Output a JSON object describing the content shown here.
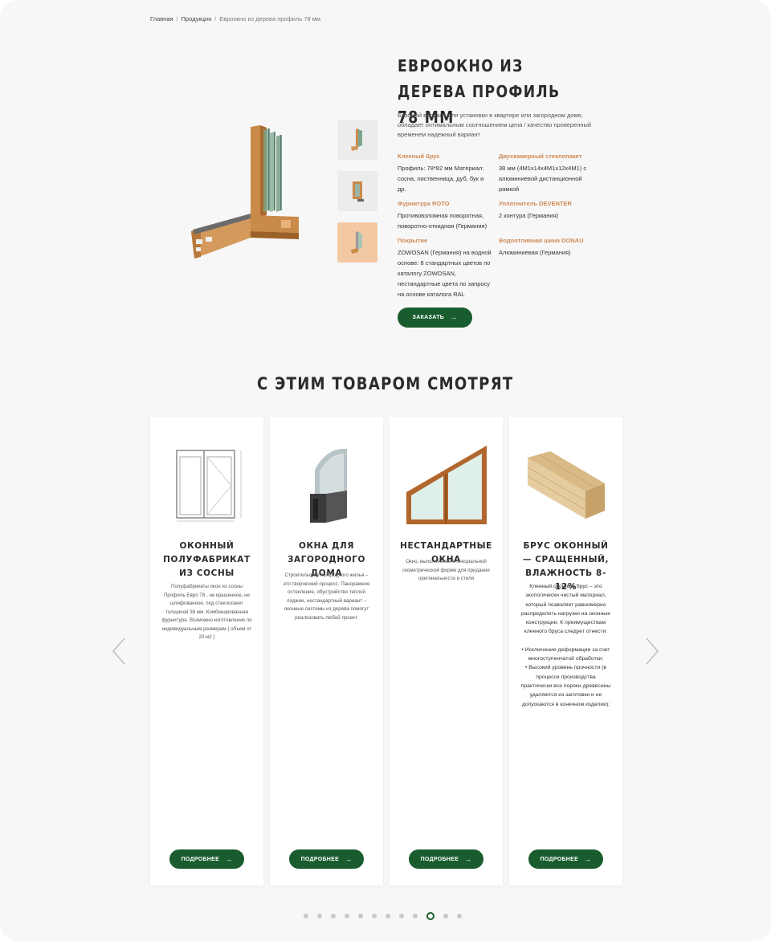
{
  "breadcrumb": {
    "home": "Главная",
    "products": "Продукция",
    "current": "Евроокно из дерева профиль 78 мм",
    "separator": "/"
  },
  "product": {
    "title": "Евроокно из дерева профиль 78 мм",
    "description": "Базовый вариант для установки в квартире или загородном доме, обладает оптимальным соотношением цена / качество проверенный временем надежный вариант",
    "specs": [
      {
        "key": "Клееный брус",
        "value": "Профиль: 78*82 мм Материал: сосна, лиственница, дуб, бук и др."
      },
      {
        "key": "Двухкамерный стеклопакет",
        "value": "38 мм (4М1х14х4М1х12х4М1) с алюминиевой дистанционной рамкой"
      },
      {
        "key": "Фурнитура ROTO",
        "value": "Противовзломная поворотная, поворотно-откидная (Германия)"
      },
      {
        "key": "Уплотнитель DEVENTER",
        "value": "2 контура (Германия)"
      },
      {
        "key": "Покрытие",
        "value": "ZOWOSAN (Германия) на водной основе: 8 стандартных цветов по каталогу ZOWOSAN, нестандартные цвета по запросу на основе каталога RAL"
      },
      {
        "key": "Водоотливная шина DONAU",
        "value": "Алюминиевая (Германия)"
      }
    ],
    "order_label": "Заказать",
    "accent_color": "#d08a55"
  },
  "related": {
    "title": "С этим товаром смотрят",
    "cards": [
      {
        "title": "Оконный полуфабрикат из сосны",
        "text": "Полуфабрикаты окон из сосны Профиль Евро 78 , не крашенное, не шлифованное, под стеклопакет толщиной 38 мм. Комбинированная фурнитура. Возможно изготовление по индивидуальным размерам ( объем от 20 м2 )",
        "button": "Подробнее"
      },
      {
        "title": "Окна для загородного дома",
        "text": "Строительство загородного жилья – это творческий процесс. Панорамное остекление, обустройство теплой лоджии, нестандартный вариант – оконные системы из дерева помогут реализовать любой проект.",
        "button": "Подробнее"
      },
      {
        "title": "Нестандартные окна",
        "text": "Окно, выполненное в специальной геометрической форме для придания оригинальности и стиля",
        "button": "Подробнее"
      },
      {
        "title": "Брус оконный — сращенный, влажность 8-12%",
        "text": "Клееный оконный брус – это экологически чистый материал, который позволяет равномерно распределить нагрузки на оконные конструкции. К преимуществам клееного бруса следует отнести:",
        "bullet1": "• Исключение деформации за счет многоступенчатой обработки;",
        "bullet2": "• Высокий уровень прочности (в процессе производства практически все пороки древесины удаляются из заготовки и не допускаются в конечном изделии);",
        "button": "Подробнее"
      }
    ]
  },
  "carousel": {
    "dot_count": 12,
    "active_index": 9
  },
  "colors": {
    "brand_green": "#195d2e",
    "background": "#f7f7f7",
    "accent_orange": "#d08a55"
  }
}
